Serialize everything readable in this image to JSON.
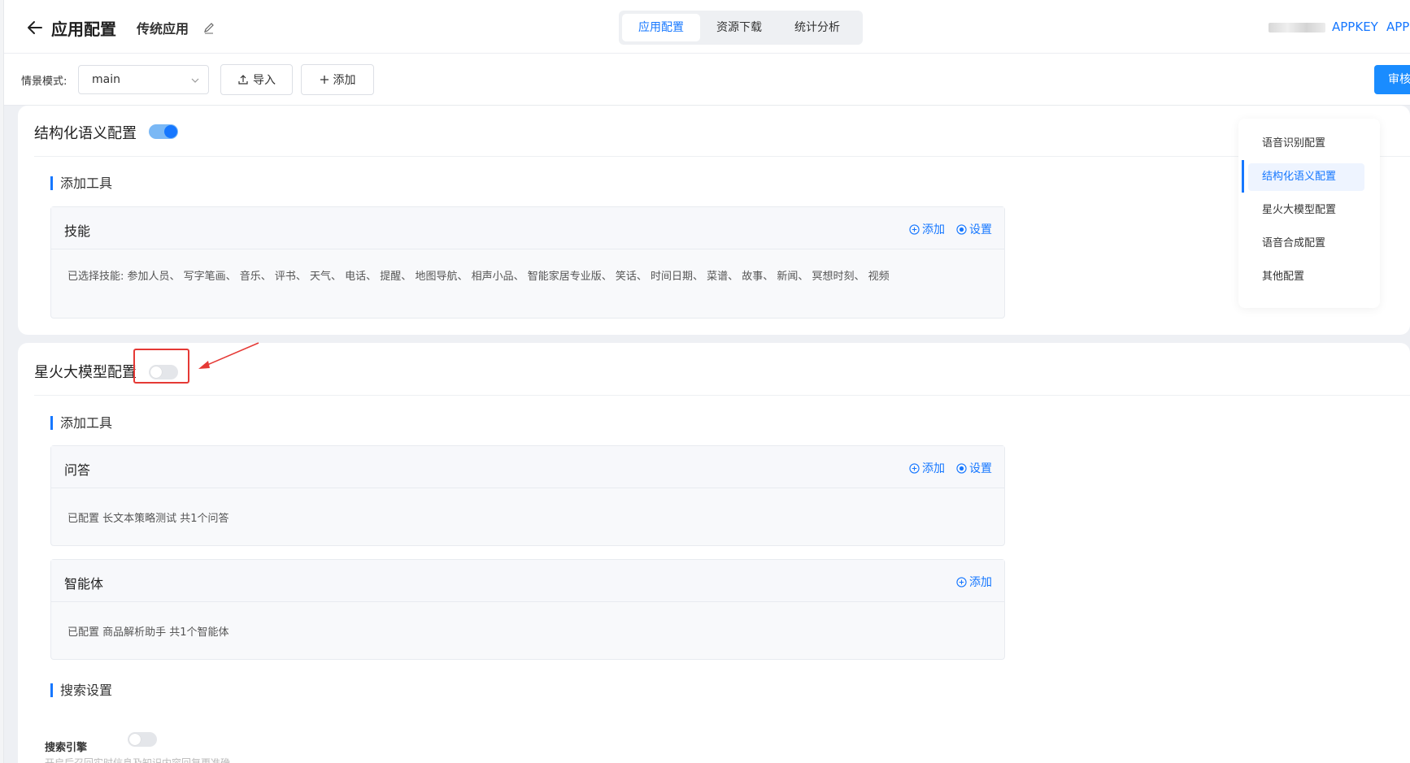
{
  "header": {
    "title": "应用配置",
    "subtitle": "传统应用",
    "tabs": [
      {
        "label": "应用配置",
        "active": true
      },
      {
        "label": "资源下载",
        "active": false
      },
      {
        "label": "统计分析",
        "active": false
      }
    ],
    "appkey_label": "APPKEY",
    "apps_label": "APPS"
  },
  "toolbar": {
    "mode_label": "情景模式:",
    "mode_value": "main",
    "import_label": "导入",
    "add_label": "添加",
    "review_label": "审核"
  },
  "structured": {
    "title": "结构化语义配置",
    "enabled": true,
    "tools_heading": "添加工具",
    "skills_panel": {
      "title": "技能",
      "add_label": "添加",
      "settings_label": "设置",
      "body": "已选择技能:  参加人员、 写字笔画、 音乐、 评书、 天气、 电话、 提醒、 地图导航、 相声小品、 智能家居专业版、 笑话、 时间日期、 菜谱、 故事、 新闻、 冥想时刻、 视频"
    }
  },
  "spark": {
    "title": "星火大模型配置",
    "enabled": false,
    "tools_heading": "添加工具",
    "qa_panel": {
      "title": "问答",
      "add_label": "添加",
      "settings_label": "设置",
      "body": "已配置 长文本策略测试 共1个问答"
    },
    "agent_panel": {
      "title": "智能体",
      "add_label": "添加",
      "body": "已配置 商品解析助手 共1个智能体"
    },
    "search_heading": "搜索设置",
    "search_engine_label": "搜索引擎",
    "search_engine_enabled": false,
    "search_hint": "开启后召回实时信息及知识内容回复更准确"
  },
  "right_nav": {
    "items": [
      {
        "label": "语音识别配置",
        "active": false
      },
      {
        "label": "结构化语义配置",
        "active": true
      },
      {
        "label": "星火大模型配置",
        "active": false
      },
      {
        "label": "语音合成配置",
        "active": false
      },
      {
        "label": "其他配置",
        "active": false
      }
    ]
  },
  "colors": {
    "accent": "#1677ff",
    "annotation": "#e53935"
  }
}
